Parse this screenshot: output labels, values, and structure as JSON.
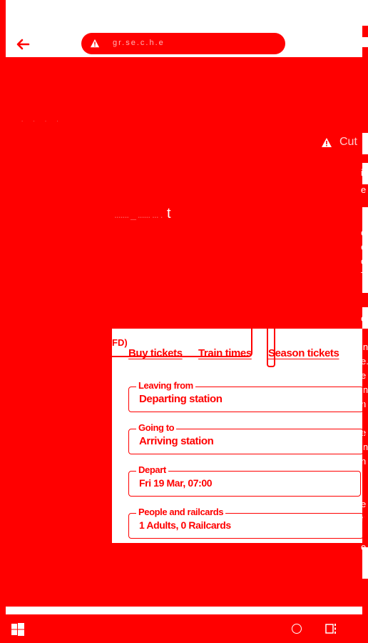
{
  "browser": {
    "address_text": "gr.se.c.h.e"
  },
  "ghost": {
    "dots": ". . . .",
    "headline_dim": "....... _ ...... ... .",
    "headline_t": "t",
    "side_text": "Cut"
  },
  "widget": {
    "fd_label": "FD)",
    "tabs": [
      {
        "label": "Buy tickets",
        "active": true
      },
      {
        "label": "Train times",
        "active": false
      },
      {
        "label": "Season tickets",
        "active": false
      }
    ],
    "fields": {
      "leaving": {
        "label": "Leaving from",
        "value": "Departing station"
      },
      "going": {
        "label": "Going to",
        "value": "Arriving station"
      },
      "depart": {
        "label": "Depart",
        "value": "Fri 19 Mar, 07:00"
      },
      "people": {
        "label": "People and railcards",
        "value": "1 Adults, 0 Railcards"
      }
    }
  },
  "edge_fragments": [
    "in",
    "e",
    "e.",
    "e",
    "or",
    "T",
    "e",
    "in",
    "e.",
    "e",
    "in",
    "n",
    "e",
    "in",
    "n",
    "e",
    "r",
    "e."
  ],
  "colors": {
    "brand": "#ff0000",
    "surface": "#ffffff"
  },
  "icons": {
    "back": "arrow-left-icon",
    "warning": "warning-triangle-icon",
    "start": "windows-start-icon",
    "search": "search-circle-icon",
    "taskview": "task-view-icon"
  }
}
